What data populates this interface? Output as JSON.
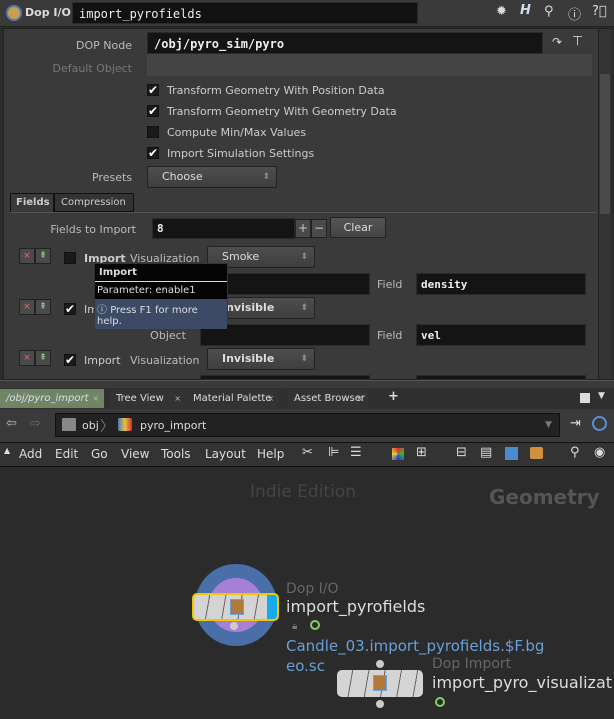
{
  "header": {
    "node_type": "Dop I/O",
    "node_name": "import_pyrofields"
  },
  "params": {
    "dop_node_label": "DOP Node",
    "dop_node_value": "/obj/pyro_sim/pyro",
    "default_object_label": "Default Object",
    "checkboxes": [
      {
        "label": "Transform Geometry With Position Data",
        "checked": true
      },
      {
        "label": "Transform Geometry With Geometry Data",
        "checked": true
      },
      {
        "label": "Compute Min/Max Values",
        "checked": false
      },
      {
        "label": "Import Simulation Settings",
        "checked": true
      }
    ],
    "presets_label": "Presets",
    "presets_value": "Choose",
    "tabs": [
      "Fields",
      "Compression"
    ],
    "fields_to_import_label": "Fields to Import",
    "fields_to_import_value": "8",
    "plus": "+",
    "minus": "−",
    "clear": "Clear",
    "import_label": "Import",
    "visualization_label": "Visualization",
    "object_label": "Object",
    "field_label": "Field",
    "rows": [
      {
        "checked": false,
        "visualization": "Smoke",
        "field": "density"
      },
      {
        "checked": true,
        "visualization": "Invisible",
        "field": "vel"
      },
      {
        "checked": true,
        "visualization": "Invisible"
      }
    ]
  },
  "tooltip": {
    "title": "Import",
    "parameter": "Parameter: enable1",
    "help": "Press F1 for more help."
  },
  "pane_tabs": [
    "/obj/pyro_import",
    "Tree View",
    "Material Palette",
    "Asset Browser"
  ],
  "path": {
    "root": "obj",
    "current": "pyro_import"
  },
  "menu": [
    "Add",
    "Edit",
    "Go",
    "View",
    "Tools",
    "Layout",
    "Help"
  ],
  "network": {
    "watermark": "Indie Edition",
    "context": "Geometry",
    "nodes": [
      {
        "type": "Dop I/O",
        "name": "import_pyrofields",
        "comment": "Candle_03.import_pyrofields.$F.bg",
        "comment2": "eo.sc"
      },
      {
        "type": "Dop Import",
        "name": "import_pyro_visualizat"
      }
    ]
  }
}
